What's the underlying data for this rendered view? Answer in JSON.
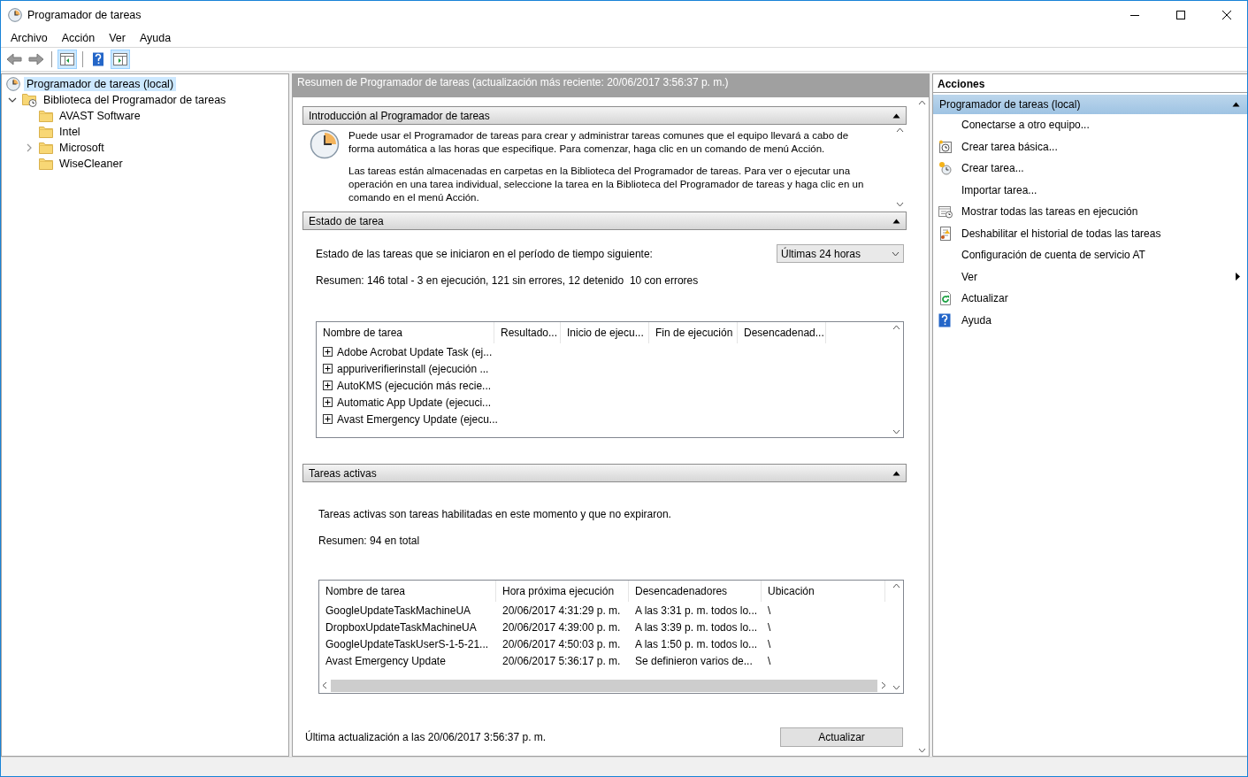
{
  "window": {
    "title": "Programador de tareas"
  },
  "menu": [
    "Archivo",
    "Acción",
    "Ver",
    "Ayuda"
  ],
  "tree": [
    {
      "label": "Programador de tareas (local)",
      "kind": "scheduler",
      "selected": true,
      "children": [
        {
          "label": "Biblioteca del Programador de tareas",
          "kind": "library",
          "selected": false,
          "expanded": true,
          "children": [
            {
              "label": "AVAST Software",
              "kind": "folder",
              "selected": false
            },
            {
              "label": "Intel",
              "kind": "folder",
              "selected": false
            },
            {
              "label": "Microsoft",
              "kind": "folder",
              "selected": false,
              "expanded": false
            },
            {
              "label": "WiseCleaner",
              "kind": "folder",
              "selected": false
            }
          ]
        }
      ]
    }
  ],
  "summary": {
    "title": "Resumen de Programador de tareas (actualización más reciente: 20/06/2017 3:56:37 p. m.)",
    "intro": {
      "title": "Introducción al Programador de tareas",
      "expanded": true,
      "paragraphs": [
        "Puede usar el Programador de tareas para crear y administrar tareas comunes que el equipo llevará a cabo de forma automática a las horas que especifique. Para comenzar, haga clic en un comando de menú Acción.",
        "Las tareas están almacenadas en carpetas en la Biblioteca del Programador de tareas. Para ver o ejecutar una operación en una tarea individual, seleccione la tarea en la Biblioteca del Programador de tareas y haga clic en un comando en el menú Acción."
      ]
    },
    "status": {
      "title": "Estado de tarea",
      "expanded": true,
      "prompt": "Estado de las tareas que se iniciaron en el período de tiempo siguiente:",
      "period": "Últimas 24 horas",
      "summary": "Resumen: 146 total - 3 en ejecución, 121 sin errores, 12 detenido  10 con errores",
      "table": {
        "columns": [
          "Nombre de tarea",
          "Resultado...",
          "Inicio de ejecu...",
          "Fin de ejecución",
          "Desencadenad..."
        ],
        "rows": [
          {
            "name": "Adobe Acrobat Update Task (ej...",
            "expanded": false
          },
          {
            "name": "appuriverifierinstall (ejecución ...",
            "expanded": false
          },
          {
            "name": "AutoKMS (ejecución más recie...",
            "expanded": false
          },
          {
            "name": "Automatic App Update (ejecuci...",
            "expanded": false
          },
          {
            "name": "Avast Emergency Update (ejecu...",
            "expanded": false
          }
        ]
      }
    },
    "active": {
      "title": "Tareas activas",
      "expanded": true,
      "description": "Tareas activas son tareas habilitadas en este momento y que no expiraron.",
      "summary": "Resumen: 94 en total",
      "table": {
        "columns": [
          "Nombre de tarea",
          "Hora próxima ejecución",
          "Desencadenadores",
          "Ubicación"
        ],
        "rows": [
          [
            "GoogleUpdateTaskMachineUA",
            "20/06/2017 4:31:29 p. m.",
            "A las 3:31 p. m. todos lo...",
            "\\"
          ],
          [
            "DropboxUpdateTaskMachineUA",
            "20/06/2017 4:39:00 p. m.",
            "A las 3:39 p. m. todos lo...",
            "\\"
          ],
          [
            "GoogleUpdateTaskUserS-1-5-21...",
            "20/06/2017 4:50:03 p. m.",
            "A las 1:50 p. m. todos lo...",
            "\\"
          ],
          [
            "Avast Emergency Update",
            "20/06/2017 5:36:17 p. m.",
            "Se definieron varios de...",
            "\\"
          ]
        ]
      }
    },
    "footer": {
      "last_update": "Última actualización a las 20/06/2017 3:56:37 p. m.",
      "button": "Actualizar"
    }
  },
  "actions": {
    "title": "Acciones",
    "groups": [
      {
        "title": "Programador de tareas (local)",
        "expanded": true,
        "items": [
          {
            "label": "Conectarse a otro equipo...",
            "kind": "plain"
          },
          {
            "label": "Crear tarea básica...",
            "kind": "basic-task"
          },
          {
            "label": "Crear tarea...",
            "kind": "new-task"
          },
          {
            "label": "Importar tarea...",
            "kind": "plain"
          },
          {
            "label": "Mostrar todas las tareas en ejecución",
            "kind": "running"
          },
          {
            "label": "Deshabilitar el historial de todas las tareas",
            "kind": "history"
          },
          {
            "label": "Configuración de cuenta de servicio AT",
            "kind": "plain"
          },
          {
            "label": "Ver",
            "kind": "submenu"
          },
          {
            "label": "Actualizar",
            "kind": "refresh"
          },
          {
            "label": "Ayuda",
            "kind": "help"
          }
        ]
      }
    ]
  }
}
